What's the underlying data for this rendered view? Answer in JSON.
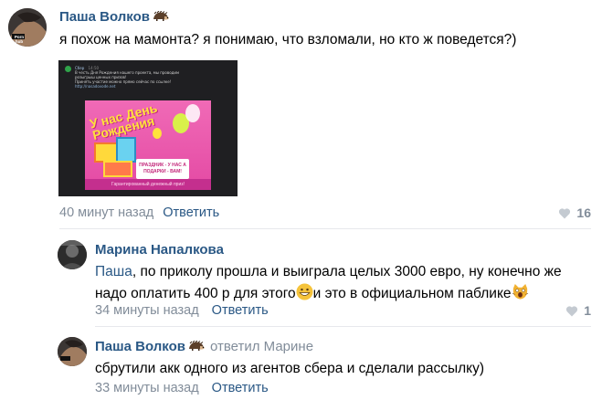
{
  "comments": [
    {
      "author": "Паша Волков",
      "avatar_badge": "Porn hub",
      "text": "я похож на мамонта? я понимаю, что взломали, но кто ж поведется?)",
      "attachment": {
        "source": "Сбер",
        "source_time": "14:50",
        "lines": [
          "В честь Дня Рождения нашего проекта, мы проводим",
          "розыгрыш ценных призов!",
          "Принять участие можно прямо сейчас по ссылке!"
        ],
        "url": "http://nasadovode.net",
        "poster_title": "У нас День Рождения",
        "poster_banner": "ПРАЗДНИК - У НАС А ПОДАРКИ - ВАМ!",
        "poster_footer": "Гарантированный денежный приз!"
      },
      "time": "40 минут назад",
      "reply_label": "Ответить",
      "likes": "16"
    },
    {
      "author": "Марина Напалкова",
      "mention": "Паша",
      "text_part1": ", по приколу прошла и выиграла целых 3000 евро, ну конечно же",
      "text_part2": "надо оплатить 400 р для этого",
      "text_part3": "и это в официальном паблике",
      "time": "34 минуты назад",
      "reply_label": "Ответить",
      "likes": "1"
    },
    {
      "author": "Паша Волков",
      "reply_to": "ответил Марине",
      "text": "сбрутили акк одного из агентов сбера и сделали рассылку)",
      "time": "33 минуты назад",
      "reply_label": "Ответить"
    }
  ],
  "icons": {
    "hedgehog": "hedgehog-icon",
    "heart": "heart-icon",
    "grin": "grinning-emoji",
    "scream": "screaming-cat-emoji"
  },
  "colors": {
    "link": "#2a5885",
    "meta": "#818c99",
    "divider": "#e7e8ec"
  }
}
